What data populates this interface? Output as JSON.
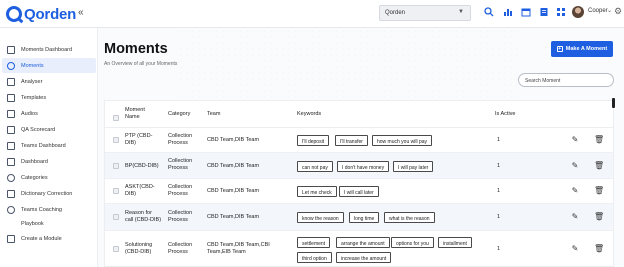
{
  "app": {
    "logo_text": "Qorden",
    "collapse_glyph": "«"
  },
  "topbar": {
    "org_select": "Qorden",
    "icons": [
      "search-icon",
      "bar-chart-icon",
      "calendar-icon",
      "document-icon",
      "grid-icon"
    ],
    "user_name": "Cooper",
    "accent_color": "#1d5fe0"
  },
  "sidebar": {
    "items": [
      {
        "label": "Moments Dashboard",
        "icon": "dashboard-icon"
      },
      {
        "label": "Moments",
        "icon": "moments-icon",
        "active": true
      },
      {
        "label": "Analyser",
        "icon": "analyser-icon"
      },
      {
        "label": "Templates",
        "icon": "templates-icon"
      },
      {
        "label": "Audios",
        "icon": "audio-icon"
      },
      {
        "label": "QA Scorecard",
        "icon": "scorecard-icon"
      },
      {
        "label": "Teams Dashboard",
        "icon": "teams-icon"
      },
      {
        "label": "Dashboard",
        "icon": "dashboard-icon"
      },
      {
        "label": "Categories",
        "icon": "categories-icon"
      },
      {
        "label": "Dictionary Correction",
        "icon": "dictionary-icon"
      },
      {
        "label": "Teams Coaching",
        "icon": "coaching-icon"
      },
      {
        "label": "Playbook",
        "icon": "playbook-icon"
      },
      {
        "label": "Create a Module",
        "icon": "module-icon"
      }
    ]
  },
  "main": {
    "title": "Moments",
    "subtitle": "An Overview of all your Moments",
    "make_button": "Make A Moment",
    "search_placeholder": "Search Moment"
  },
  "table": {
    "headers": {
      "name": "Moment\nName",
      "category": "Category",
      "team": "Team",
      "keywords": "Keywords",
      "active": "Is Active"
    },
    "rows": [
      {
        "name": "PTP (CBD-\nDIB)",
        "category": "Collection\nProcess",
        "team": "CBD Team,DIB Team",
        "keywords": [
          "I'll deposit",
          "I'll transfer",
          "how much you will pay"
        ],
        "active": "1"
      },
      {
        "name": "BP(CBD-DIB)",
        "category": "Collection\nProcess",
        "team": "CBD Team,DIB Team",
        "keywords": [
          "can not pay",
          "I don't have money",
          "I will pay later"
        ],
        "active": "1"
      },
      {
        "name": "ASKT(CBD-\nDIB)",
        "category": "Collection\nProcess",
        "team": "CBD Team,DIB Team",
        "keywords": [
          "Let me check",
          "I will call later"
        ],
        "active": "1"
      },
      {
        "name": "Reason for\ncall (CBD-DIB)",
        "category": "Collection\nProcess",
        "team": "CBD Team,DIB Team",
        "keywords": [
          "know the reason",
          "long time",
          "what is the reason"
        ],
        "active": "1"
      },
      {
        "name": "Solutioning\n(CBD-DIB)",
        "category": "Collection\nProcess",
        "team": "CBD Team,DIB Team,CBI\nTeam,EIB Team",
        "keywords": [
          "settlement",
          "arrange the amount",
          "options for you",
          "installment",
          "third option",
          "increase the amount"
        ],
        "active": "1"
      }
    ]
  }
}
